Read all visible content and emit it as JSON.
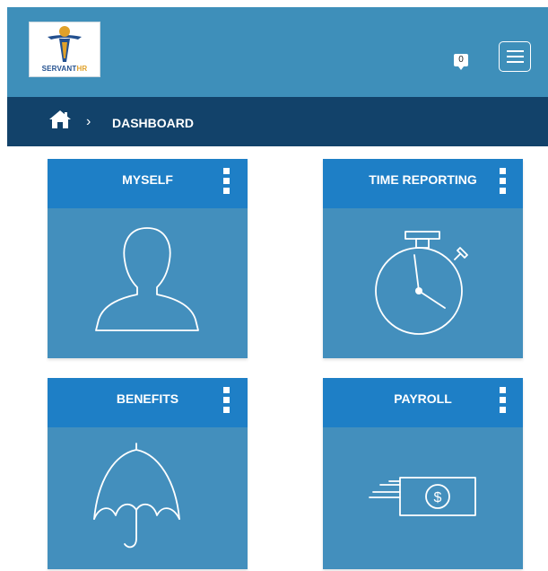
{
  "header": {
    "logo": {
      "brand_primary": "SERVANT",
      "brand_accent": "HR"
    },
    "notifications": {
      "count": "0"
    },
    "menu_icon": "hamburger-icon"
  },
  "breadcrumb": {
    "home_icon": "home-icon",
    "separator": "›",
    "current": "DASHBOARD"
  },
  "tiles": [
    {
      "title": "MYSELF",
      "icon": "person-icon"
    },
    {
      "title": "TIME REPORTING",
      "icon": "stopwatch-icon"
    },
    {
      "title": "BENEFITS",
      "icon": "umbrella-icon"
    },
    {
      "title": "PAYROLL",
      "icon": "money-transfer-icon"
    }
  ],
  "colors": {
    "header_bg": "#3e8fba",
    "breadcrumb_bg": "#12426a",
    "tile_header_bg": "#1e7fc6",
    "tile_body_bg": "#438fbd"
  }
}
